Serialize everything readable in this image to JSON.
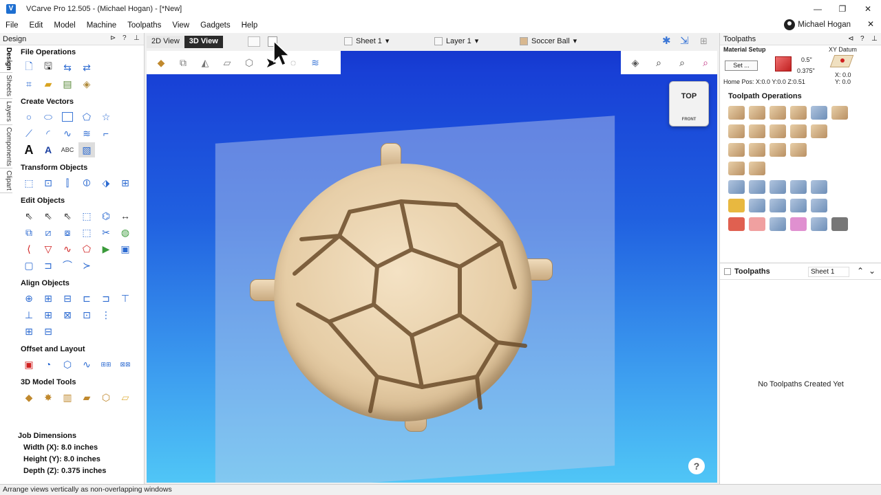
{
  "window": {
    "title": "VCarve Pro 12.505 - (Michael Hogan) - [*New]",
    "app_icon": "V",
    "minimize": "—",
    "maximize": "❐",
    "close": "✕"
  },
  "menu": {
    "items": [
      "File",
      "Edit",
      "Model",
      "Machine",
      "Toolpaths",
      "View",
      "Gadgets",
      "Help"
    ],
    "user": "Michael Hogan",
    "close": "✕"
  },
  "left_panel": {
    "title": "Design",
    "side_tabs": [
      "Design",
      "Sheets",
      "Layers",
      "Components",
      "Clipart"
    ],
    "sections": [
      "File Operations",
      "Create Vectors",
      "Transform Objects",
      "Edit Objects",
      "Align Objects",
      "Offset and Layout",
      "3D Model Tools"
    ],
    "job_dimensions": {
      "title": "Job Dimensions",
      "width": "Width  (X): 8.0 inches",
      "height": "Height (Y): 8.0 inches",
      "depth": "Depth  (Z): 0.375 inches"
    }
  },
  "view_tabs": {
    "tab_2d": "2D View",
    "tab_3d": "3D View",
    "active": "3D View"
  },
  "selectors": {
    "sheet": "Sheet 1",
    "layer": "Layer 1",
    "component": "Soccer Ball"
  },
  "viewport": {
    "viewcube_top": "TOP",
    "viewcube_front": "FRONT",
    "help": "?"
  },
  "right_panel": {
    "title": "Toolpaths",
    "material_setup": "Material Setup",
    "set_button": "Set ...",
    "thickness": "0.5\"",
    "depth": "0.375\"",
    "xy_datum": "XY Datum",
    "x": "X: 0.0",
    "y": "Y: 0.0",
    "home_pos": "Home Pos:  X:0.0 Y:0.0 Z:0.51",
    "toolpath_operations": "Toolpath Operations",
    "toolpaths_list_title": "Toolpaths",
    "sheet_select": "Sheet 1",
    "empty_message": "No Toolpaths Created Yet"
  },
  "status": {
    "text": "Arrange views vertically as non-overlapping windows"
  }
}
